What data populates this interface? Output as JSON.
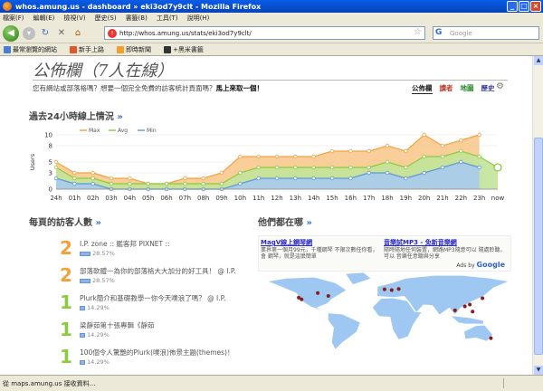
{
  "window": {
    "title": "whos.amung.us - dashboard » eki3od7y9clt - Mozilla Firefox"
  },
  "menu": [
    "檔案(F)",
    "編輯(E)",
    "檢視(V)",
    "歷史(S)",
    "書籤(B)",
    "工具(T)",
    "說明(H)"
  ],
  "nav": {
    "url": "http://whos.amung.us/stats/eki3od7y9clt/",
    "search_placeholder": "Google"
  },
  "bookmarks": [
    "最常瀏覽的網站",
    "新手上路",
    "即時新聞",
    "+黑米書籤"
  ],
  "page": {
    "title": "公佈欄（7人在線）",
    "promo_text": "您有網站或部落格嗎？想要一個完全免費的訪客統計頁面嗎？",
    "promo_link": "馬上來取一個！",
    "tabs": [
      "公佈欄",
      "讀者",
      "地圖",
      "歷史"
    ]
  },
  "sections": {
    "chart_title": "過去24小時線上情況",
    "visits_title": "每頁的訪客人數",
    "where_title": "他們都在哪",
    "arrow": "»"
  },
  "visits": [
    {
      "rank": "2",
      "title": "I.P. zone :: 鑑客邦 PIXNET ::",
      "pct": "28.57%",
      "share": 0.2857
    },
    {
      "rank": "2",
      "title": "部落軟體一為你的部落格大大加分的好工具！ @ I.P.",
      "pct": "28.57%",
      "share": 0.2857
    },
    {
      "rank": "1",
      "title": "Plurk簡介和基礎教學一你今天噗浪了嗎？ @ I.P.",
      "pct": "14.29%",
      "share": 0.1429
    },
    {
      "rank": "1",
      "title": "梁靜茹第十張專輯《靜茹",
      "pct": "14.29%",
      "share": 0.1429
    },
    {
      "rank": "1",
      "title": "100個令人驚艷的Plurk(噗浪)佈景主題(themes)！",
      "pct": "14.29%",
      "share": 0.1429
    }
  ],
  "rank_colors": {
    "2": "#f0a33a",
    "1": "#8ccb3d"
  },
  "ads": [
    {
      "head": "MagV線上鋼琴網",
      "text": "業界第一個月99元，千種鋼琴 不限次數任你看，會 鋼琴，就是這麼簡單"
    },
    {
      "head": "音樂試MP3 - 免新音樂網",
      "text": "隨時隨地任何裝置，網路MP3隨意可以 隨處聆聽，可以 音樂任意聽與分享"
    }
  ],
  "ads_by": "Ads by",
  "ads_brand": "Google",
  "status": "從 maps.amung.us 接收資料…",
  "chart_data": {
    "type": "area",
    "ylabel": "Users",
    "ylim": [
      0,
      10
    ],
    "yticks": [
      0,
      3,
      5,
      8,
      10
    ],
    "categories": [
      "24h",
      "01h",
      "02h",
      "03h",
      "04h",
      "05h",
      "06h",
      "07h",
      "08h",
      "09h",
      "10h",
      "11h",
      "12h",
      "13h",
      "14h",
      "15h",
      "16h",
      "17h",
      "18h",
      "19h",
      "20h",
      "21h",
      "22h",
      "23h",
      "now"
    ],
    "legend": "top-left",
    "series": [
      {
        "name": "Max",
        "color": "#f5a142",
        "values": [
          5,
          3,
          3,
          2,
          2,
          1,
          1,
          2,
          2,
          3,
          6,
          6,
          6,
          6,
          6,
          7,
          7,
          7,
          8,
          7,
          10,
          8,
          9,
          10,
          null
        ]
      },
      {
        "name": "Avg",
        "color": "#8ccb3d",
        "values": [
          4,
          2,
          2,
          1,
          1,
          1,
          1,
          1,
          1,
          1,
          3,
          4,
          4,
          4,
          4,
          4,
          4,
          4,
          5,
          4,
          6,
          6,
          7,
          6,
          4
        ]
      },
      {
        "name": "Min",
        "color": "#5b9bd5",
        "values": [
          2,
          1,
          1,
          0,
          0,
          0,
          0,
          0,
          0,
          0,
          1,
          2,
          2,
          2,
          2,
          2,
          2,
          3,
          3,
          2,
          3,
          4,
          5,
          4,
          null
        ]
      }
    ]
  },
  "map": {
    "land_color": "#9ec8f2",
    "marker_color": "#8b1a1a",
    "markers": [
      {
        "lon": -122,
        "lat": 37
      },
      {
        "lon": -118,
        "lat": 34
      },
      {
        "lon": -95,
        "lat": 45
      },
      {
        "lon": -80,
        "lat": 40
      },
      {
        "lon": -0.1,
        "lat": 51.5
      },
      {
        "lon": 10,
        "lat": 50
      },
      {
        "lon": 20,
        "lat": 52
      },
      {
        "lon": 100,
        "lat": 15
      },
      {
        "lon": 114,
        "lat": 22
      },
      {
        "lon": 121,
        "lat": 25
      },
      {
        "lon": 125,
        "lat": 13
      },
      {
        "lon": 139,
        "lat": 36
      },
      {
        "lon": 151,
        "lat": -33
      }
    ]
  }
}
